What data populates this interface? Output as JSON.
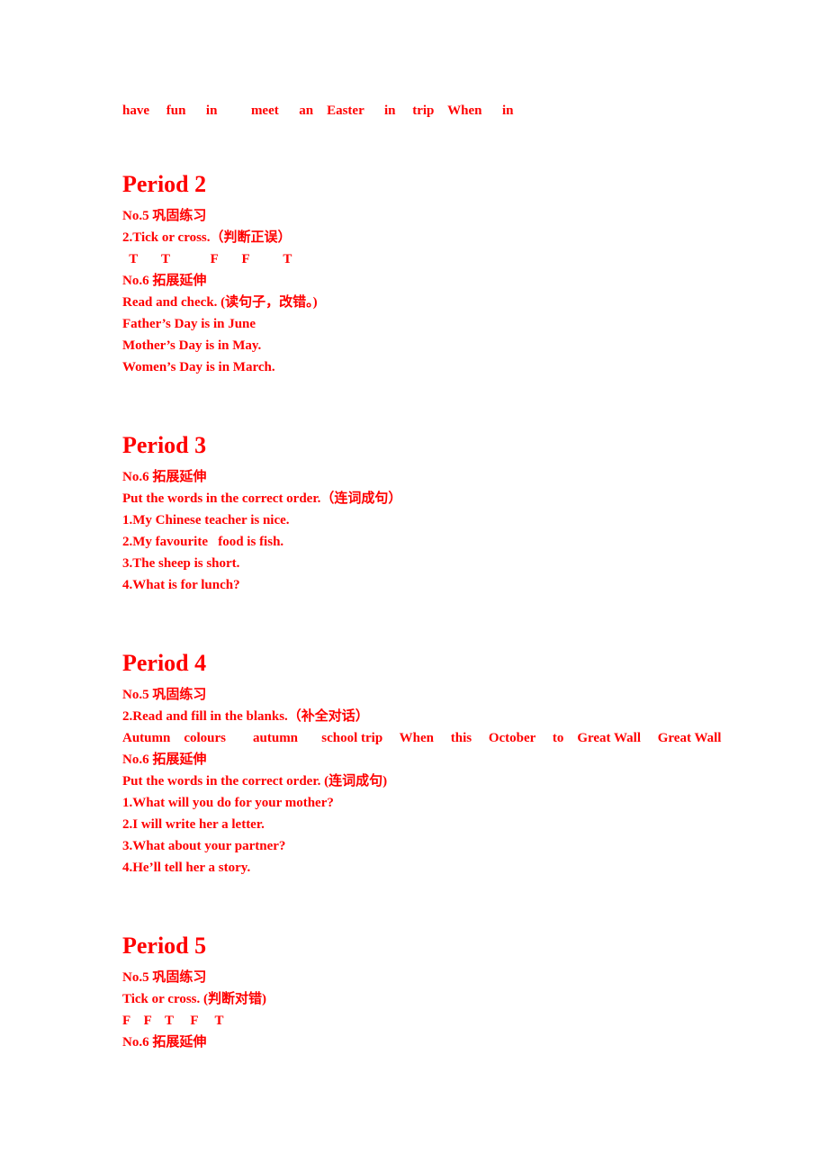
{
  "document": {
    "page_background": "#ffffff",
    "text_color": "#ff0000"
  },
  "top_word_list": {
    "name": "word-bank-continued",
    "text": "have     fun      in          meet      an    Easter      in     trip    When      in"
  },
  "sections": [
    {
      "heading": "Period 2",
      "lines": [
        {
          "type": "label",
          "text": "No.5 巩固练习"
        },
        {
          "type": "task",
          "text": "2.Tick or cross.（判断正误）"
        },
        {
          "type": "answers",
          "text": "  T       T            F       F          T"
        },
        {
          "type": "label",
          "text": "No.6 拓展延伸"
        },
        {
          "type": "task",
          "text": "Read and check. (读句子，改错。)"
        },
        {
          "type": "answer-sentence",
          "text": "Father’s Day is in June"
        },
        {
          "type": "answer-sentence",
          "text": "Mother’s Day is in May."
        },
        {
          "type": "answer-sentence",
          "text": "Women’s Day is in March."
        }
      ]
    },
    {
      "heading": "Period 3",
      "lines": [
        {
          "type": "label",
          "text": "No.6 拓展延伸"
        },
        {
          "type": "task",
          "text": "Put the words in the correct order.（连词成句）"
        },
        {
          "type": "answer-sentence",
          "text": "1.My Chinese teacher is nice."
        },
        {
          "type": "answer-sentence",
          "text": "2.My favourite   food is fish."
        },
        {
          "type": "answer-sentence",
          "text": "3.The sheep is short."
        },
        {
          "type": "answer-sentence",
          "text": "4.What is for lunch?"
        }
      ]
    },
    {
      "heading": "Period 4",
      "lines": [
        {
          "type": "label",
          "text": "No.5 巩固练习"
        },
        {
          "type": "task",
          "text": "2.Read and fill in the blanks.（补全对话）"
        },
        {
          "type": "answers-wrap",
          "text": "Autumn    colours        autumn       school trip     When     this     October     to    Great Wall     Great Wall"
        },
        {
          "type": "label",
          "text": "No.6 拓展延伸"
        },
        {
          "type": "task",
          "text": "Put the words in the correct order. (连词成句)"
        },
        {
          "type": "answer-sentence",
          "text": "1.What will you do for your mother?"
        },
        {
          "type": "answer-sentence",
          "text": "2.I will write her a letter."
        },
        {
          "type": "answer-sentence",
          "text": "3.What about your partner?"
        },
        {
          "type": "answer-sentence",
          "text": "4.He’ll tell her a story."
        }
      ]
    },
    {
      "heading": "Period 5",
      "lines": [
        {
          "type": "label",
          "text": "No.5 巩固练习"
        },
        {
          "type": "task",
          "text": "Tick or cross. (判断对错)"
        },
        {
          "type": "answers",
          "text": "F    F    T     F     T"
        },
        {
          "type": "label",
          "text": "No.6 拓展延伸"
        }
      ]
    }
  ]
}
